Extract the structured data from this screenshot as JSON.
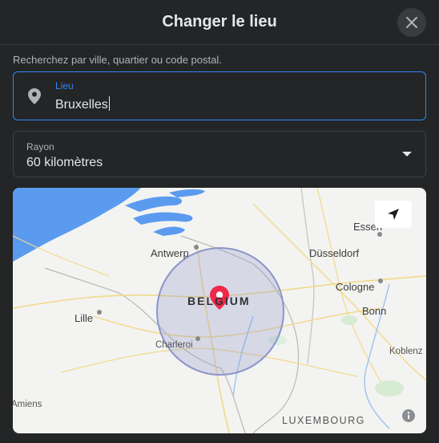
{
  "dialog": {
    "title": "Changer le lieu",
    "close_icon": "close-icon"
  },
  "search": {
    "hint": "Recherchez par ville, quartier ou code postal.",
    "label": "Lieu",
    "value": "Bruxelles",
    "icon": "location-pin-icon"
  },
  "radius": {
    "label": "Rayon",
    "value": "60 kilomètres",
    "icon": "dropdown-arrow-icon"
  },
  "map": {
    "cities": {
      "antwerp": "Antwerp",
      "essen": "Essen",
      "dusseldorf": "Düsseldorf",
      "cologne": "Cologne",
      "bonn": "Bonn",
      "lille": "Lille",
      "charleroi": "Charleroi",
      "koblenz": "Koblenz",
      "amiens": "Amiens"
    },
    "countries": {
      "belgium": "BELGIUM",
      "luxembourg": "LUXEMBOURG"
    },
    "radius_circle_color": "#8b95c9",
    "marker_color": "#f02849",
    "water_color": "#5a9bf0",
    "locate_icon": "navigation-arrow-icon",
    "info_icon": "info-icon"
  }
}
